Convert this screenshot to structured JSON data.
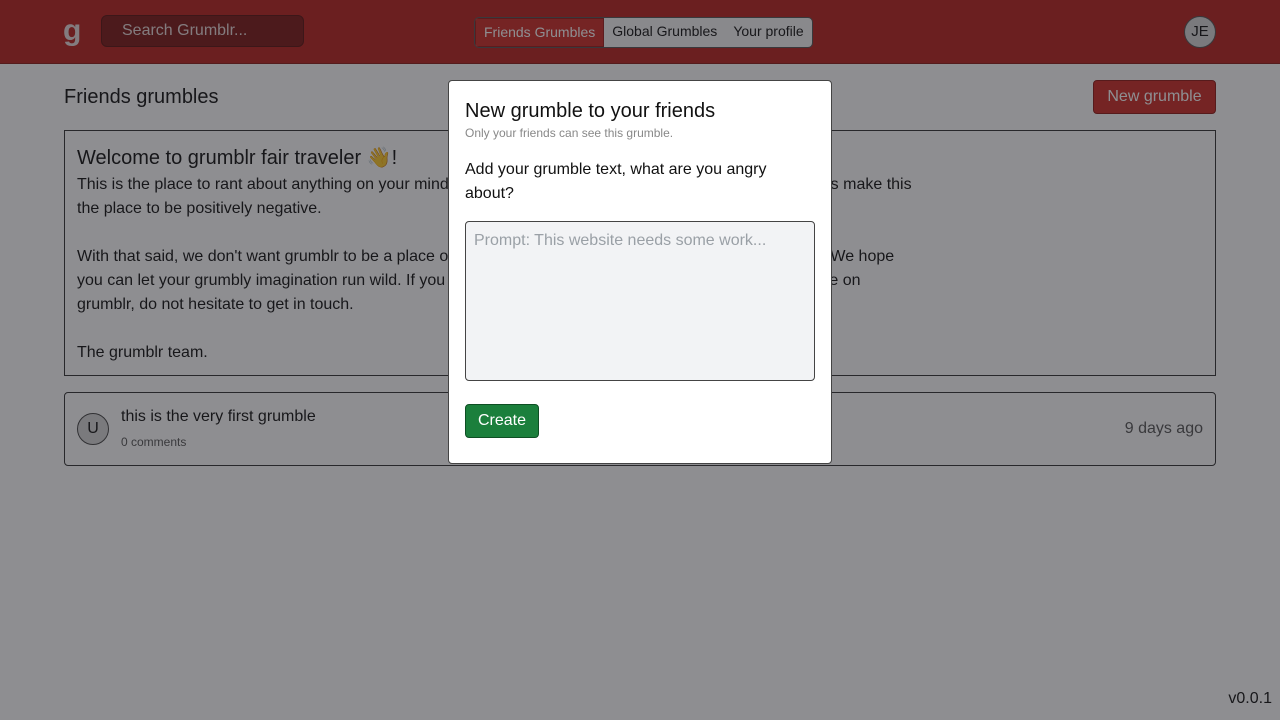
{
  "header": {
    "logo": "g",
    "search_text": "Search Grumblr...",
    "tabs": [
      {
        "label": "Friends Grumbles",
        "active": true
      },
      {
        "label": "Global Grumbles",
        "active": false
      },
      {
        "label": "Your profile",
        "active": false
      }
    ],
    "user_initials": "JE"
  },
  "main": {
    "page_title": "Friends grumbles",
    "new_button": "New grumble",
    "welcome": {
      "title": "Welcome to grumblr fair traveler 👋!",
      "p1": "This is the place to rant about anything on your mind. While positivity is encouraged on other platforms, let's make this the place to be positively negative.",
      "p2": "With that said, we don't want grumblr to be a place of hate, just a place where you can let off some steam. We hope you can let your grumbly imagination run wild. If you have any suggestions or features you would like to see on grumblr, do not hesitate to get in touch.",
      "p3": "The grumblr team."
    },
    "grumble": {
      "avatar": "U",
      "text": "this is the very first grumble",
      "comments": "0 comments",
      "time": "9 days ago"
    }
  },
  "modal": {
    "title": "New grumble to your friends",
    "subtitle": "Only your friends can see this grumble.",
    "label": "Add your grumble text, what are you angry about?",
    "placeholder": "Prompt: This website needs some work...",
    "create_button": "Create"
  },
  "version": "v0.0.1",
  "colors": {
    "brand_red": "#b8211d",
    "create_green": "#1b7f3c"
  }
}
